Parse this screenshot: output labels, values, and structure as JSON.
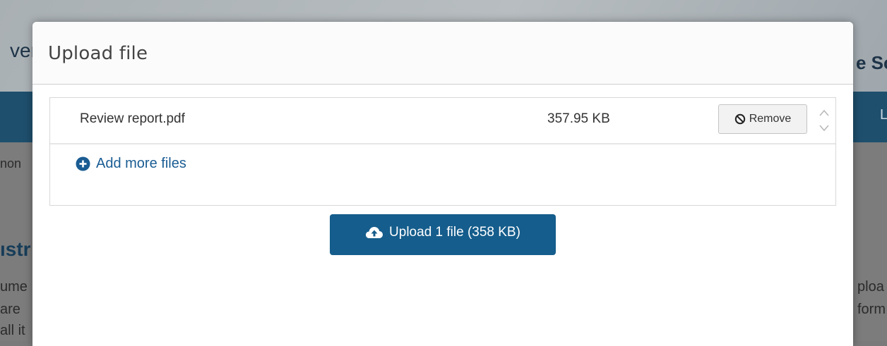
{
  "background": {
    "header_left_fragment": "ver",
    "header_right_fragment": "e Sc",
    "nav_right_fragment": "L",
    "breadcrumb_fragment": "non",
    "heading_fragment": "ıstr",
    "para_left_fragments": [
      "ume",
      "are",
      "all it"
    ],
    "para_right_fragments": [
      "ploa",
      "form"
    ]
  },
  "modal": {
    "title": "Upload file",
    "files": [
      {
        "name": "Review report.pdf",
        "size": "357.95 KB",
        "remove_label": "Remove"
      }
    ],
    "add_more_label": "Add more files",
    "upload_button_label": "Upload 1 file (358 KB)"
  },
  "colors": {
    "primary_button": "#155d8c",
    "link": "#1a5c93",
    "nav_bar": "#1e4f6d"
  },
  "icons": [
    "ban-icon",
    "chevron-up-icon",
    "chevron-down-icon",
    "plus-circle-icon",
    "cloud-upload-icon"
  ]
}
